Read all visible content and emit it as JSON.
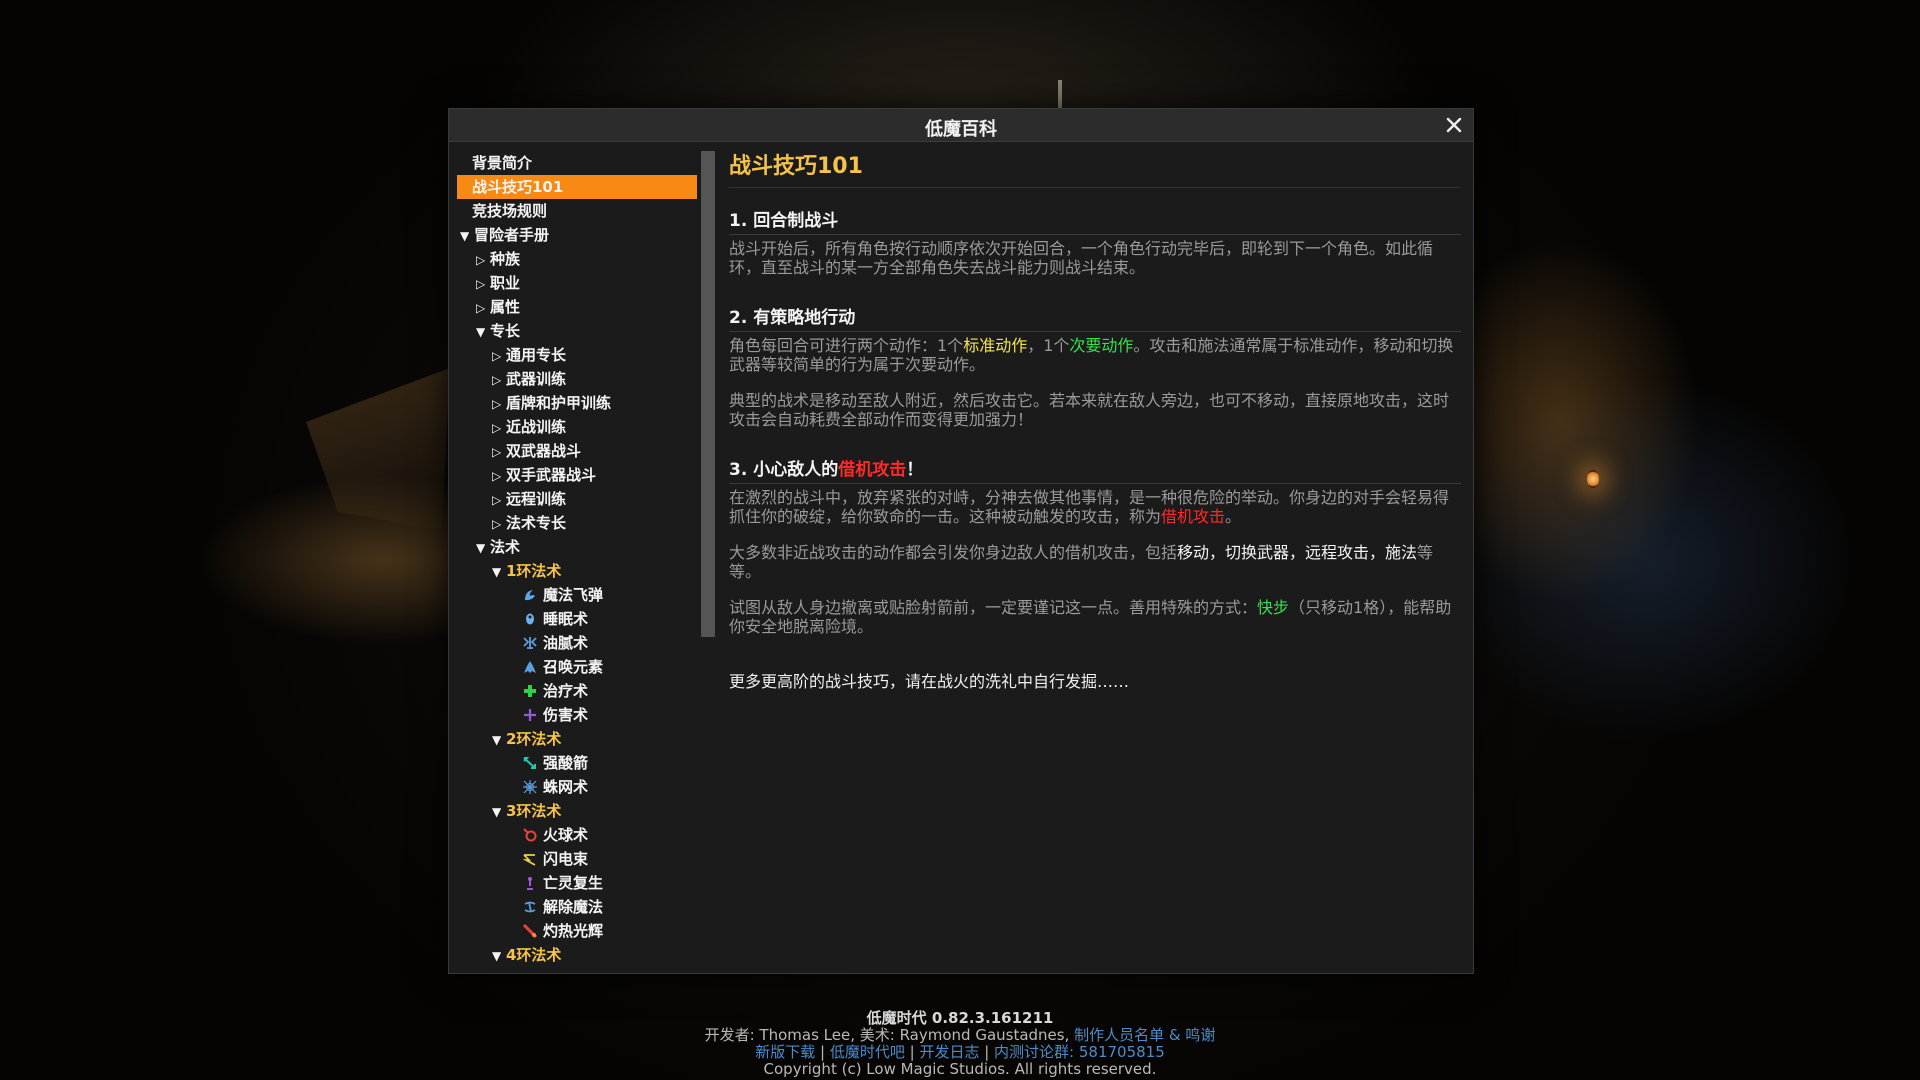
{
  "window": {
    "title": "低魔百科"
  },
  "sidebar": {
    "items": [
      {
        "label": "背景简介"
      },
      {
        "label": "战斗技巧101"
      },
      {
        "label": "竞技场规则"
      },
      {
        "label": "冒险者手册",
        "arrow": "▼"
      },
      {
        "label": "种族",
        "arrow": "▷"
      },
      {
        "label": "职业",
        "arrow": "▷"
      },
      {
        "label": "属性",
        "arrow": "▷"
      },
      {
        "label": "专长",
        "arrow": "▼"
      },
      {
        "label": "通用专长",
        "arrow": "▷"
      },
      {
        "label": "武器训练",
        "arrow": "▷"
      },
      {
        "label": "盾牌和护甲训练",
        "arrow": "▷"
      },
      {
        "label": "近战训练",
        "arrow": "▷"
      },
      {
        "label": "双武器战斗",
        "arrow": "▷"
      },
      {
        "label": "双手武器战斗",
        "arrow": "▷"
      },
      {
        "label": "远程训练",
        "arrow": "▷"
      },
      {
        "label": "法术专长",
        "arrow": "▷"
      },
      {
        "label": "法术",
        "arrow": "▼"
      },
      {
        "label": "1环法术",
        "arrow": "▼"
      },
      {
        "label": "魔法飞弹",
        "icon": "magic-missile-icon"
      },
      {
        "label": "睡眠术",
        "icon": "sleep-icon"
      },
      {
        "label": "油腻术",
        "icon": "grease-icon"
      },
      {
        "label": "召唤元素",
        "icon": "summon-elemental-icon"
      },
      {
        "label": "治疗术",
        "icon": "heal-icon"
      },
      {
        "label": "伤害术",
        "icon": "harm-icon"
      },
      {
        "label": "2环法术",
        "arrow": "▼"
      },
      {
        "label": "强酸箭",
        "icon": "acid-arrow-icon"
      },
      {
        "label": "蛛网术",
        "icon": "web-icon"
      },
      {
        "label": "3环法术",
        "arrow": "▼"
      },
      {
        "label": "火球术",
        "icon": "fireball-icon"
      },
      {
        "label": "闪电束",
        "icon": "lightning-bolt-icon"
      },
      {
        "label": "亡灵复生",
        "icon": "raise-dead-icon"
      },
      {
        "label": "解除魔法",
        "icon": "dispel-magic-icon"
      },
      {
        "label": "灼热光辉",
        "icon": "searing-light-icon"
      },
      {
        "label": "4环法术",
        "arrow": "▼"
      }
    ]
  },
  "content": {
    "title": "战斗技巧101",
    "s1": {
      "heading": "1. 回合制战斗",
      "p1": "战斗开始后，所有角色按行动顺序依次开始回合，一个角色行动完毕后，即轮到下一个角色。如此循环，直至战斗的某一方全部角色失去战斗能力则战斗结束。"
    },
    "s2": {
      "heading": "2. 有策略地行动",
      "p1_a": "角色每回合可进行两个动作：1个",
      "p1_b": "标准动作",
      "p1_c": "，1个",
      "p1_d": "次要动作",
      "p1_e": "。攻击和施法通常属于标准动作，移动和切换武器等较简单的行为属于次要动作。",
      "p2": "典型的战术是移动至敌人附近，然后攻击它。若本来就在敌人旁边，也可不移动，直接原地攻击，这时攻击会自动耗费全部动作而变得更加强力！"
    },
    "s3": {
      "heading_a": "3. 小心敌人的",
      "heading_b": "借机攻击",
      "heading_c": "！",
      "p1_a": "在激烈的战斗中，放弃紧张的对峙，分神去做其他事情，是一种很危险的举动。你身边的对手会轻易得抓住你的破绽，给你致命的一击。这种被动触发的攻击，称为",
      "p1_b": "借机攻击",
      "p1_c": "。",
      "p2_a": "大多数非近战攻击的动作都会引发你身边敌人的借机攻击，包括",
      "p2_b": "移动，切换武器，远程攻击，施法",
      "p2_c": "等等。",
      "p3_a": "试图从敌人身边撤离或贴脸射箭前，一定要谨记这一点。善用特殊的方式：",
      "p3_b": "快步",
      "p3_c": "（只移动1格），能帮助你安全地脱离险境。"
    },
    "closing": "更多更高阶的战斗技巧，请在战火的洗礼中自行发掘……"
  },
  "footer": {
    "version": "低魔时代 0.82.3.161211",
    "credits_a": "开发者: Thomas Lee, 美术: Raymond Gaustadnes, ",
    "credits_link": "制作人员名单 & 鸣谢",
    "link_download": "新版下载",
    "link_tieba": "低魔时代吧",
    "link_devlog": "开发日志",
    "link_group": "内测讨论群: 581705815",
    "sep": " | ",
    "copyright": "Copyright (c) Low Magic Studios. All rights reserved."
  }
}
